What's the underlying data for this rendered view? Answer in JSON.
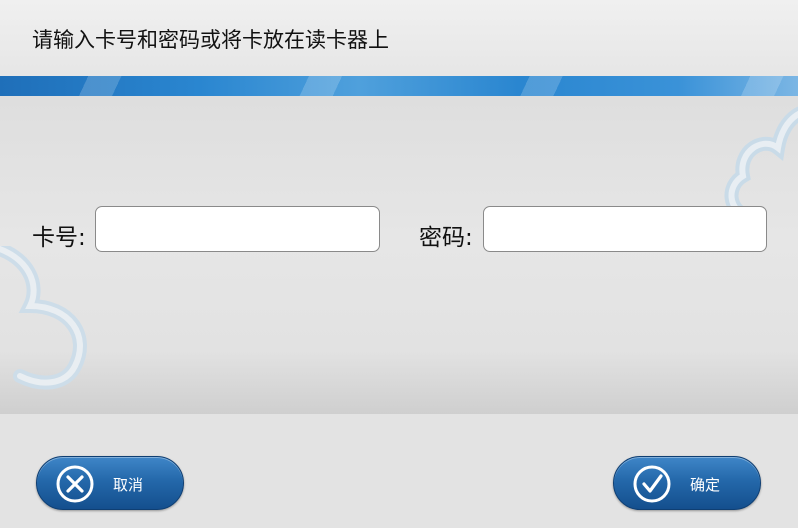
{
  "dialog": {
    "title": "请输入卡号和密码或将卡放在读卡器上"
  },
  "form": {
    "card_number": {
      "label": "卡号:",
      "value": ""
    },
    "password": {
      "label": "密码:",
      "value": ""
    }
  },
  "buttons": {
    "cancel": {
      "label": "取消",
      "icon": "close-circle-icon"
    },
    "confirm": {
      "label": "确定",
      "icon": "checkmark-circle-icon"
    }
  },
  "colors": {
    "accent": "#2a86d0",
    "button": "#2468aa",
    "background": "#e4e4e4"
  }
}
